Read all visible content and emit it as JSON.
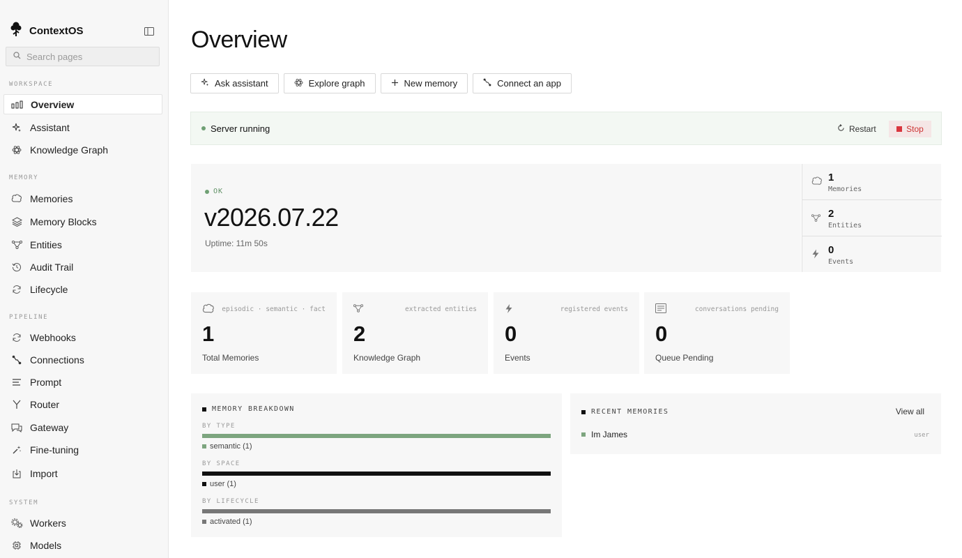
{
  "brand": {
    "name": "ContextOS"
  },
  "search": {
    "placeholder": "Search pages"
  },
  "sidebar": {
    "sections": {
      "workspace": "WORKSPACE",
      "memory": "MEMORY",
      "pipeline": "PIPELINE",
      "system": "SYSTEM"
    },
    "items": {
      "overview": "Overview",
      "assistant": "Assistant",
      "knowledge_graph": "Knowledge Graph",
      "memories": "Memories",
      "memory_blocks": "Memory Blocks",
      "entities": "Entities",
      "audit_trail": "Audit Trail",
      "lifecycle": "Lifecycle",
      "webhooks": "Webhooks",
      "connections": "Connections",
      "prompt": "Prompt",
      "router": "Router",
      "gateway": "Gateway",
      "fine_tuning": "Fine-tuning",
      "import": "Import",
      "workers": "Workers",
      "models": "Models"
    }
  },
  "page": {
    "title": "Overview"
  },
  "actions": {
    "ask_assistant": "Ask assistant",
    "explore_graph": "Explore graph",
    "new_memory": "New memory",
    "connect_app": "Connect an app"
  },
  "server": {
    "status": "Server running",
    "restart": "Restart",
    "stop": "Stop",
    "status_color": "#6fa074",
    "stop_color": "#d9363e"
  },
  "version_card": {
    "status": "OK",
    "version": "v2026.07.22",
    "uptime": "Uptime: 11m 50s"
  },
  "side_stats": {
    "memories": {
      "value": "1",
      "label": "Memories"
    },
    "entities": {
      "value": "2",
      "label": "Entities"
    },
    "events": {
      "value": "0",
      "label": "Events"
    }
  },
  "metrics": {
    "total_memories": {
      "tag": "episodic · semantic · fact",
      "value": "1",
      "label": "Total Memories"
    },
    "knowledge_graph": {
      "tag": "extracted entities",
      "value": "2",
      "label": "Knowledge Graph"
    },
    "events": {
      "tag": "registered events",
      "value": "0",
      "label": "Events"
    },
    "queue": {
      "tag": "conversations pending",
      "value": "0",
      "label": "Queue Pending"
    }
  },
  "breakdown": {
    "title": "MEMORY BREAKDOWN",
    "by_type": {
      "label": "BY TYPE",
      "legend": "semantic (1)",
      "color": "#7da57f",
      "fraction": 1.0
    },
    "by_space": {
      "label": "BY SPACE",
      "legend": "user (1)",
      "color": "#111111",
      "fraction": 1.0
    },
    "by_lifecycle": {
      "label": "BY LIFECYCLE",
      "legend": "activated (1)",
      "color": "#777777",
      "fraction": 1.0
    }
  },
  "recent": {
    "title": "RECENT MEMORIES",
    "view_all": "View all",
    "items": [
      {
        "text": "Im James",
        "space": "user"
      }
    ]
  }
}
